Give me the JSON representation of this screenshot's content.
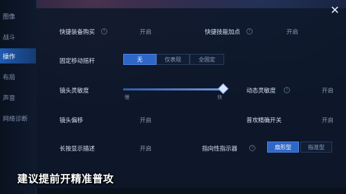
{
  "sidebar": {
    "items": [
      {
        "label": "图像"
      },
      {
        "label": "战斗"
      },
      {
        "label": "操作"
      },
      {
        "label": "布局"
      },
      {
        "label": "声音"
      },
      {
        "label": "网络诊断"
      }
    ],
    "active_index": 2
  },
  "settings": {
    "quick_buy": {
      "label": "快捷装备购买",
      "value": "开启"
    },
    "quick_skill": {
      "label": "快捷技能加点",
      "value": "开启"
    },
    "fixed_joystick": {
      "label": "固定移动摇杆",
      "options": [
        "无",
        "仅表现",
        "全固定"
      ],
      "selected": "无"
    },
    "camera_sensitivity": {
      "label": "镜头灵敏度",
      "min_label": "慢",
      "max_label": "快",
      "level_fraction": 0.98
    },
    "dynamic_sensitivity": {
      "label": "动态灵敏度",
      "value": "开启"
    },
    "camera_offset": {
      "label": "镜头偏移",
      "value": "开启"
    },
    "precise_attack": {
      "label": "普攻精确开关",
      "value": "开启"
    },
    "long_press_desc": {
      "label": "长按显示描述",
      "value": "开启"
    },
    "direction_indicator": {
      "label": "指向性指示器",
      "options": [
        "扇形型",
        "指准型"
      ],
      "selected": "扇形型"
    }
  },
  "caption": "建议提前开精准普攻",
  "close_symbol": "✕",
  "colors": {
    "accent": "#2f67c8",
    "active_tab": "#1f5bb0"
  }
}
